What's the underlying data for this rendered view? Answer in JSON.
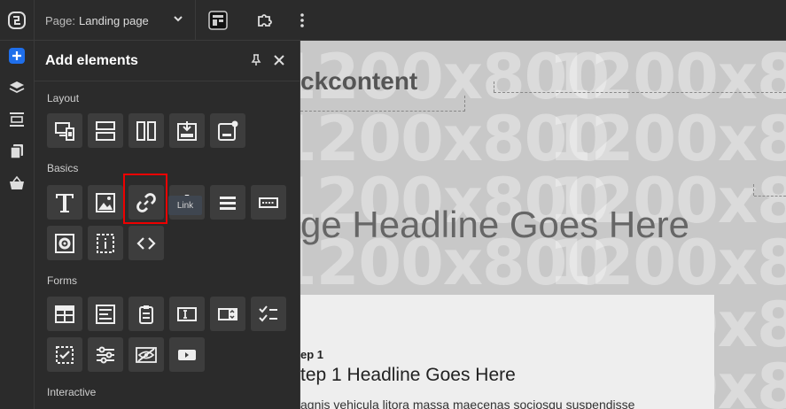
{
  "topbar": {
    "page_prefix": "Page:",
    "page_name": "Landing page"
  },
  "panel": {
    "title": "Add elements",
    "sections": {
      "layout": "Layout",
      "basics": "Basics",
      "forms": "Forms",
      "interactive": "Interactive"
    },
    "tooltip": "Link"
  },
  "canvas": {
    "watermark": "1200x800",
    "block_label": "ckcontent",
    "headline": "ge Headline Goes Here",
    "card": {
      "step_label": "ep 1",
      "step_headline": "tep 1 Headline Goes Here",
      "step_body": "agnis vehicula litora massa maecenas sociosqu suspendisse"
    }
  },
  "colors": {
    "accent": "#1f6feb",
    "highlight": "#ee0000",
    "panel_bg": "#2b2b2b",
    "tile_bg": "#3d3d3d"
  }
}
